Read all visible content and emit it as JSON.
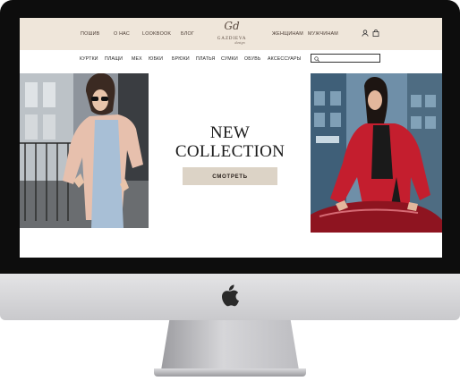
{
  "header": {
    "nav_left": [
      "ПОШИВ",
      "О НАС",
      "LOOKBOOK",
      "БЛОГ"
    ],
    "brand_mark": "Gd",
    "brand_name": "GAZDIEVA",
    "brand_tag": "design",
    "nav_right": [
      "ЖЕНЩИНАМ",
      "МУЖЧИНАМ"
    ],
    "icons": [
      "user-icon",
      "bag-icon"
    ]
  },
  "categories": [
    "КУРТКИ",
    "ПЛАЩИ",
    "МЕХ",
    "ЮБКИ",
    "БРЮКИ",
    "ПЛАТЬЯ",
    "СУМКИ",
    "ОБУВЬ",
    "АКСЕССУАРЫ"
  ],
  "search": {
    "placeholder": "",
    "icon": "search-icon"
  },
  "hero": {
    "title_line1": "NEW",
    "title_line2": "COLLECTION",
    "button_label": "СМОТРЕТЬ"
  },
  "device": {
    "logo_icon": "apple-logo-icon"
  },
  "colors": {
    "header_bg": "#efe6da",
    "button_bg": "#dcd3c6",
    "text_dark": "#1a1a1a",
    "jacket_red": "#c41e2e",
    "jacket_pink": "#e7c0ad"
  }
}
